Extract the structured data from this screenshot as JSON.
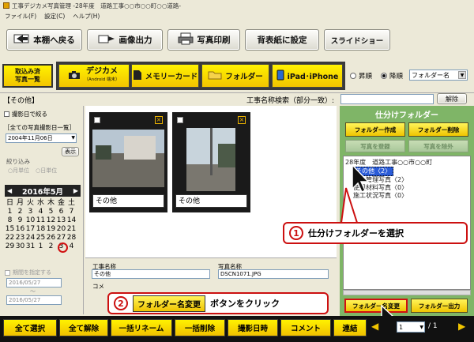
{
  "window": {
    "title": "工事デジカメ写真管理 -28年度　道路工事○○市○○町○○道路-"
  },
  "menu": [
    "ファイル(F)",
    "設定(C)",
    "ヘルプ(H)"
  ],
  "toolbar": {
    "back": "本棚へ戻る",
    "image_out": "画像出力",
    "print": "写真印刷",
    "spine": "背表紙に設定",
    "slideshow": "スライドショー"
  },
  "sources": {
    "imported_line1": "取込み済",
    "imported_line2": "写真一覧",
    "digicam": "デジカメ",
    "digicam_sub": "（Android 端末）",
    "memory": "メモリーカード",
    "folder": "フォルダー",
    "ipad": "iPad･iPhone",
    "asc": "昇順",
    "desc": "降順",
    "sort_select": "フォルダー名"
  },
  "panel": {
    "folder_label": "【その他】",
    "search_label": "工事名称検索（部分一致）:",
    "search_value": "",
    "clear": "解除"
  },
  "left": {
    "date_filter": "撮影日で絞る",
    "date_list_title": "［全ての写真撮影日一覧］",
    "date_select": "2004年11月06日",
    "show": "表示",
    "narrow": "絞り込み",
    "month_unit": "月単位",
    "day_unit": "日単位",
    "cal_title": "2016年5月",
    "cal_header": [
      "日",
      "月",
      "火",
      "水",
      "木",
      "金",
      "土"
    ],
    "cal_rows": [
      [
        "1",
        "2",
        "3",
        "4",
        "5",
        "6",
        "7"
      ],
      [
        "8",
        "9",
        "10",
        "11",
        "12",
        "13",
        "14"
      ],
      [
        "15",
        "16",
        "17",
        "18",
        "19",
        "20",
        "21"
      ],
      [
        "22",
        "23",
        "24",
        "25",
        "26",
        "27",
        "28"
      ],
      [
        "29",
        "30",
        "31",
        "1",
        "2",
        "3",
        "4"
      ]
    ],
    "period": "期間を指定する",
    "from": "2016/05/27",
    "tilde": "～",
    "to": "2016/05/27"
  },
  "thumbs": [
    {
      "label": "その他"
    },
    {
      "label": "その他"
    }
  ],
  "info": {
    "work_name_label": "工事名称",
    "work_name": "その他",
    "photo_name_label": "写真名称",
    "photo_name": "DSCN1071.JPG",
    "comment_label": "コメ"
  },
  "right": {
    "title": "仕分けフォルダー",
    "create": "フォルダー作成",
    "delete": "フォルダー削除",
    "register": "写真を登録",
    "remove": "写真を除外",
    "tree": [
      "28年度　道路工事○○市○○町",
      "その他〈2〉",
      "安全管理写真〈2〉",
      "使用材料写真〈0〉",
      "施工状況写真〈0〉"
    ],
    "rename": "フォルダー名変更",
    "output": "フォルダー出力"
  },
  "callouts": {
    "one_num": "1",
    "one_text": "仕分けフォルダーを選択",
    "two_num": "2",
    "two_btn": "フォルダー名変更",
    "two_text": "ボタンをクリック"
  },
  "bottom": {
    "select_all": "全て選択",
    "deselect_all": "全て解除",
    "rename": "一括リネーム",
    "delete": "一括削除",
    "date": "撮影日時",
    "comment": "コメント",
    "link": "連結",
    "page": "1",
    "pages": "/ 1"
  }
}
